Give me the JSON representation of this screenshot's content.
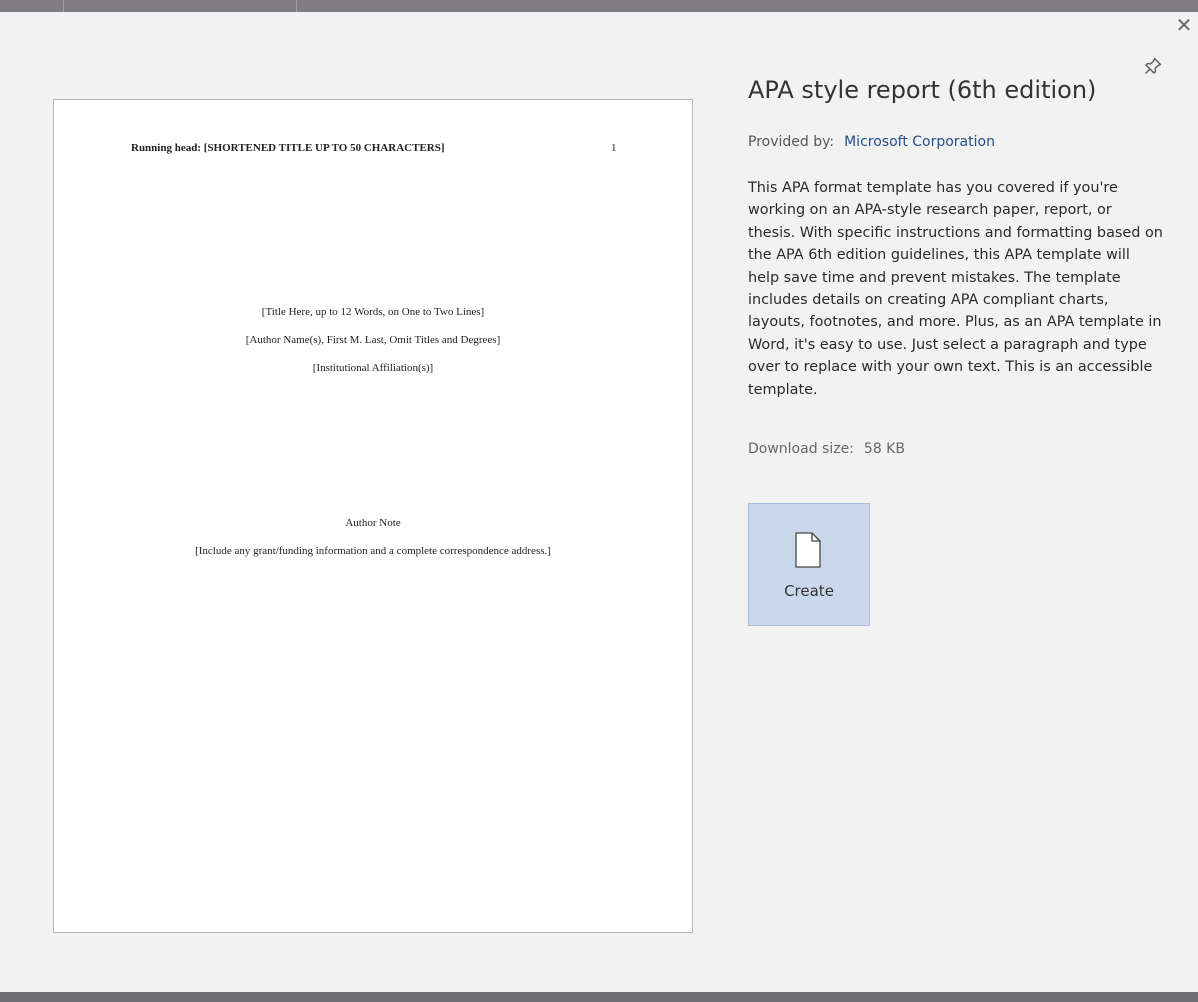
{
  "window": {
    "close_glyph": "✕"
  },
  "preview": {
    "running_head": "Running head: [SHORTENED TITLE UP TO 50 CHARACTERS]",
    "page_number": "1",
    "title_line": "[Title Here, up to 12 Words, on One to Two Lines]",
    "author_line": "[Author Name(s), First M. Last, Omit Titles and Degrees]",
    "affiliation_line": "[Institutional Affiliation(s)]",
    "author_note_heading": "Author Note",
    "author_note_text": "[Include any grant/funding information and a complete correspondence address.]"
  },
  "panel": {
    "title": "APA style report (6th edition)",
    "provided_label": "Provided by:",
    "provider": "Microsoft Corporation",
    "description": "This APA format template has you covered if you're working on an APA-style research paper, report, or thesis. With specific instructions and formatting based on the APA 6th edition guidelines, this APA template will help save time and prevent mistakes. The template includes details on creating APA compliant charts, layouts, footnotes, and more. Plus, as an APA template in Word, it's easy to use. Just select a paragraph and type over to replace with your own text. This is an accessible template.",
    "download_label": "Download size:",
    "download_value": "58 KB",
    "create_label": "Create"
  },
  "icons": {
    "pin": "pin-icon",
    "close": "close-icon",
    "document": "document-icon"
  },
  "colors": {
    "accent_link": "#264f8a",
    "create_button_bg": "#cbd8ec",
    "background": "#f2f2f2"
  }
}
